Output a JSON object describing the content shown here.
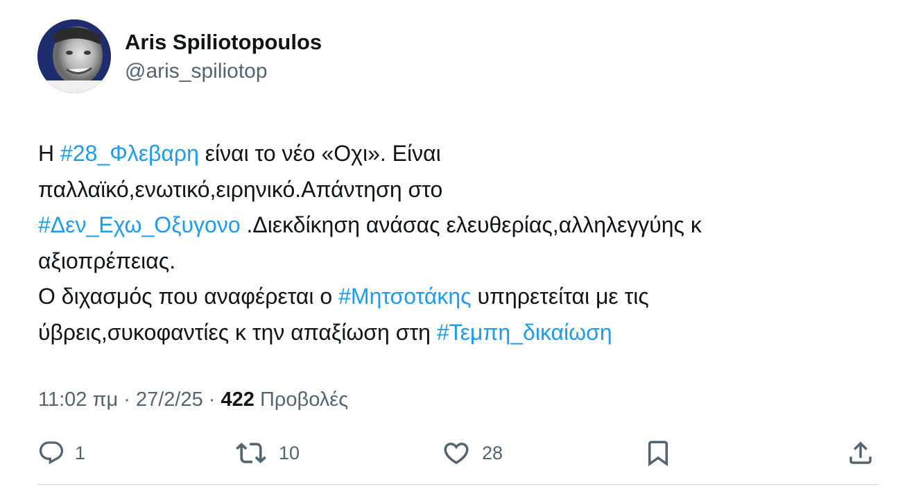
{
  "author": {
    "name": "Aris Spiliotopoulos",
    "handle": "@aris_spiliotop"
  },
  "tweet": {
    "lines": [
      [
        {
          "text": "Η ",
          "tag": false
        },
        {
          "text": "#28_Φλεβαρη",
          "tag": true
        },
        {
          "text": " είναι το νέο «Οχι».   Είναι",
          "tag": false
        }
      ],
      [
        {
          "text": "παλλαϊκό,ενωτικό,ειρηνικό.Απάντηση στο",
          "tag": false
        }
      ],
      [
        {
          "text": "#Δεν_Εχω_Οξυγονο",
          "tag": true
        },
        {
          "text": " .Διεκδίκηση ανάσας ελευθερίας,αλληλεγγύης κ",
          "tag": false
        }
      ],
      [
        {
          "text": "αξιοπρέπειας.",
          "tag": false
        }
      ],
      [
        {
          "text": "Ο διχασμός που αναφέρεται ο ",
          "tag": false
        },
        {
          "text": "#Μητσοτάκης",
          "tag": true
        },
        {
          "text": " υπηρετείται με τις",
          "tag": false
        }
      ],
      [
        {
          "text": "ύβρεις,συκοφαντίες κ  την απαξίωση στη ",
          "tag": false
        },
        {
          "text": "#Τεμπη_δικαίωση",
          "tag": true
        }
      ]
    ]
  },
  "meta": {
    "time": "11:02 πμ",
    "separator": " · ",
    "date": "27/2/25",
    "views_count": "422",
    "views_label": "Προβολές"
  },
  "actions": {
    "replies": "1",
    "reposts": "10",
    "likes": "28"
  },
  "colors": {
    "hashtag": "#1d9bf0",
    "secondary_text": "#536471",
    "primary_text": "#0f1419",
    "divider": "#cfd9de"
  },
  "icons": {
    "reply": "reply-icon",
    "repost": "repost-icon",
    "like": "heart-icon",
    "bookmark": "bookmark-icon",
    "share": "share-icon"
  }
}
